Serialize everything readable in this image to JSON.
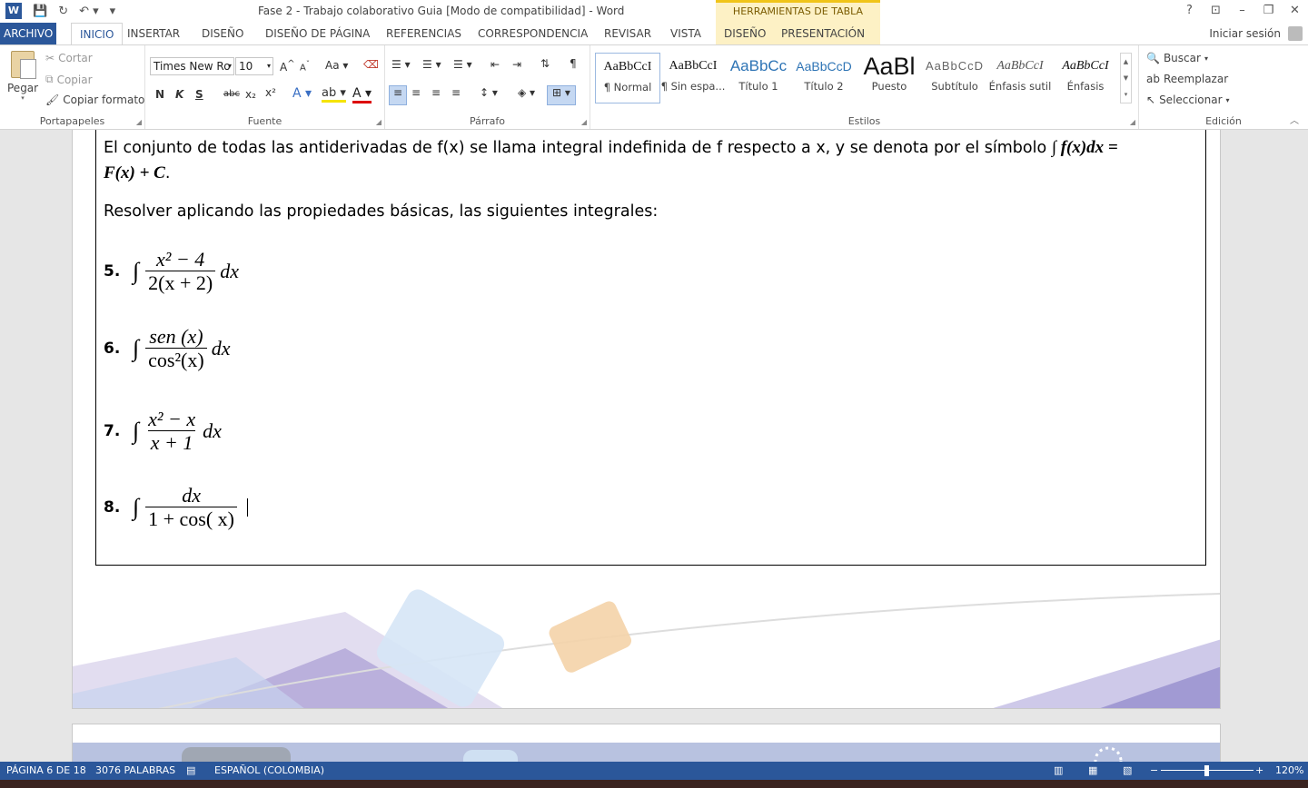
{
  "titlebar": {
    "title": "Fase 2 - Trabajo colaborativo Guia [Modo de compatibilidad] - Word",
    "tools_label": "HERRAMIENTAS DE TABLA",
    "help": "?",
    "restore_ribbon": "⊡",
    "minimize": "–",
    "maximize": "❐",
    "close": "✕",
    "qat_icons": [
      "word-icon",
      "save-icon",
      "redo-icon",
      "undo-icon",
      "customize-qat-icon"
    ]
  },
  "tabs": {
    "archivo": "ARCHIVO",
    "inicio": "INICIO",
    "insertar": "INSERTAR",
    "diseno": "DISEÑO",
    "diseno_pagina": "DISEÑO DE PÁGINA",
    "referencias": "REFERENCIAS",
    "correspondencia": "CORRESPONDENCIA",
    "revisar": "REVISAR",
    "vista": "VISTA",
    "diseno_tabla": "DISEÑO",
    "presentacion": "PRESENTACIÓN",
    "signin": "Iniciar sesión"
  },
  "ribbon": {
    "portapapeles": {
      "label": "Portapapeles",
      "pegar": "Pegar",
      "cortar": "Cortar",
      "copiar": "Copiar",
      "copiar_formato": "Copiar formato"
    },
    "fuente": {
      "label": "Fuente",
      "font_name": "Times New Ro",
      "font_size": "10",
      "bold": "N",
      "italic": "K",
      "underline": "S",
      "strike": "abc",
      "subscript": "x₂",
      "superscript": "x²",
      "grow": "A",
      "shrink": "A",
      "case": "Aa"
    },
    "parrafo": {
      "label": "Párrafo"
    },
    "estilos": {
      "label": "Estilos",
      "items": [
        {
          "sample": "AaBbCcI",
          "name": "¶ Normal"
        },
        {
          "sample": "AaBbCcI",
          "name": "¶ Sin espa..."
        },
        {
          "sample": "AaBbCc",
          "name": "Título 1"
        },
        {
          "sample": "AaBbCcD",
          "name": "Título 2"
        },
        {
          "sample": "AaBl",
          "name": "Puesto"
        },
        {
          "sample": "AaBbCcD",
          "name": "Subtítulo"
        },
        {
          "sample": "AaBbCcI",
          "name": "Énfasis sutil"
        },
        {
          "sample": "AaBbCcI",
          "name": "Énfasis"
        }
      ]
    },
    "edicion": {
      "label": "Edición",
      "buscar": "Buscar",
      "reemplazar": "Reemplazar",
      "seleccionar": "Seleccionar"
    }
  },
  "document": {
    "para1_text": "El conjunto de todas las antiderivadas de f(x) se llama integral indefinida de f respecto a x, y se denota por el símbolo ",
    "para1_math1": "∫ f(x)dx =",
    "para1_math2": "F(x) + C",
    "para1_end": ".",
    "para2": "Resolver aplicando las propiedades básicas, las siguientes integrales:",
    "items": [
      {
        "num": "5.",
        "numer": "x² − 4",
        "denom": "2(x + 2)",
        "tail": "dx"
      },
      {
        "num": "6.",
        "numer": "sen (x)",
        "denom": "cos²(x)",
        "tail": "dx"
      },
      {
        "num": "7.",
        "numer": "x² − x",
        "denom": "x + 1",
        "tail": "dx"
      },
      {
        "num": "8.",
        "numer": "dx",
        "denom": "1 + cos( x)",
        "tail": ""
      }
    ],
    "integral_symbol": "∫"
  },
  "statusbar": {
    "page": "PÁGINA 6 DE 18",
    "words": "3076 PALABRAS",
    "language": "ESPAÑOL (COLOMBIA)",
    "zoom": "120%"
  }
}
